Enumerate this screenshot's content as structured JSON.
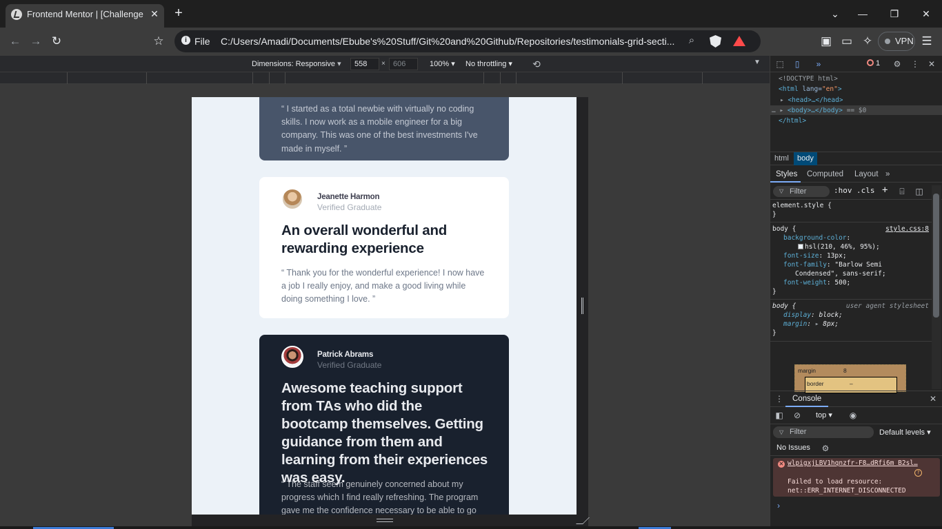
{
  "browser": {
    "tab_title": "Frontend Mentor | [Challenge N",
    "tab_close": "✕",
    "new_tab": "+",
    "window_controls": {
      "dropdown": "⌄",
      "minimize": "—",
      "maximize": "❐",
      "close": "✕"
    },
    "nav": {
      "back": "←",
      "forward": "→",
      "reload": "↻",
      "bookmark": "☆"
    },
    "scheme_label": "File",
    "url": "C:/Users/Amadi/Documents/Ebube's%20Stuff/Git%20and%20Github/Repositories/testimonials-grid-secti...",
    "vpn_label": "VPN",
    "icons": [
      "search-icon",
      "brave-shield-icon",
      "brave-rewards-icon",
      "sidebar-icon",
      "wallet-icon",
      "leo-ai-icon",
      "menu-icon"
    ]
  },
  "device_toolbar": {
    "dimensions_label": "Dimensions: Responsive",
    "width": "558",
    "times": "×",
    "height": "606",
    "zoom": "100%",
    "throttling": "No throttling"
  },
  "page": {
    "cards": [
      {
        "quote": "“ I started as a total newbie with virtually no coding skills. I now work as a mobile engineer for a big company. This was one of the best investments I've made in myself. ”"
      },
      {
        "name": "Jeanette Harmon",
        "role": "Verified Graduate",
        "headline": "An overall wonderful and rewarding experience",
        "quote": "“ Thank you for the wonderful experience! I now have a job I really enjoy, and make a good living while doing something I love. ”"
      },
      {
        "name": "Patrick Abrams",
        "role": "Verified Graduate",
        "headline": "Awesome teaching support from TAs who did the bootcamp themselves. Getting guidance from them and learning from their experiences was easy.",
        "quote": "“ The staff seem genuinely concerned about my progress which I find really refreshing. The program gave me the confidence necessary to be able to go"
      }
    ]
  },
  "devtools": {
    "error_count": "1",
    "dom": {
      "doctype": "<!DOCTYPE html>",
      "html_open_tag": "<html",
      "lang_attr": " lang=",
      "lang_val": "\"en\"",
      "html_close_bracket": ">",
      "head": "<head>…</head>",
      "body": "<body>…</body>",
      "body_eq": " == $0",
      "html_close": "</html>"
    },
    "breadcrumbs": [
      "html",
      "body"
    ],
    "panel_tabs": [
      "Styles",
      "Computed",
      "Layout",
      "»"
    ],
    "styles_filter": "Filter",
    "styles_opts": [
      ":hov",
      ".cls",
      "+"
    ],
    "rules": {
      "element_style": "element.style {",
      "close": "}",
      "body_sel": "body {",
      "source": "style.css:8",
      "bg_prop": "background-color",
      "bg_val": "hsl(210, 46%, 95%);",
      "fs_prop": "font-size",
      "fs_val": "13px;",
      "ff_prop": "font-family",
      "ff_val1": "\"Barlow Semi",
      "ff_val2": "Condensed\", sans-serif;",
      "fw_prop": "font-weight",
      "fw_val": "500;",
      "ua_sel": "body {",
      "ua_label": "user agent stylesheet",
      "display_prop": "display",
      "display_val": "block;",
      "margin_prop": "margin",
      "margin_val": "8px;"
    },
    "box_model": {
      "margin_label": "margin",
      "margin_val": "8",
      "border_label": "border",
      "border_val": "–"
    },
    "drawer_tab": "Console",
    "console_context": "top ▾",
    "console_filter": "Filter",
    "default_levels": "Default levels ▾",
    "issues": "No Issues",
    "error_link": "wlpigxjLBV1hqnzfr-F8…dRfi6m B2sl…",
    "error_line1": "Failed to load resource:",
    "error_line2": "net::ERR_INTERNET_DISCONNECTED",
    "prompt": "›"
  },
  "colors": {
    "page_bg": "#eef3f8",
    "card_grayish_blue": "#48556a",
    "card_white": "#ffffff",
    "card_dark": "#19212e",
    "devtools_tag": "#5db0d7",
    "error_bg": "#4e3534"
  }
}
